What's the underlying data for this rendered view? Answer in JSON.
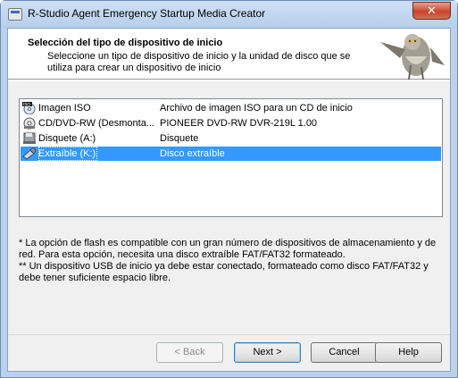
{
  "window": {
    "title": "R-Studio Agent Emergency Startup Media Creator",
    "close_label": "✕"
  },
  "header": {
    "title": "Selección del tipo de dispositivo de inicio",
    "subtitle": "Seleccione un tipo de dispositivo de inicio y la unidad de disco que se utiliza para crear un dispositivo de inicio"
  },
  "devices": [
    {
      "icon": "iso-disc-icon",
      "name": "Imagen ISO",
      "description": "Archivo de imagen ISO para un CD de inicio",
      "selected": false
    },
    {
      "icon": "optical-drive-icon",
      "name": "CD/DVD-RW (Desmonta...",
      "description": "PIONEER DVD-RW  DVR-219L 1.00",
      "selected": false
    },
    {
      "icon": "floppy-drive-icon",
      "name": "Disquete (A:)",
      "description": "Disquete",
      "selected": false
    },
    {
      "icon": "usb-drive-icon",
      "name": "Extraíble (K:)",
      "description": "Disco extraíble",
      "selected": true
    }
  ],
  "notes": {
    "line1": "* La opción de flash es compatible con un gran número de dispositivos de almacenamiento y de red. Para esta opción, necesita una disco extraíble FAT/FAT32 formateado.",
    "line2": "** Un dispositivo USB de inicio ya debe estar conectado, formateado como disco FAT/FAT32 y debe tener suficiente espacio libre."
  },
  "buttons": {
    "back": "< Back",
    "next": "Next >",
    "cancel": "Cancel",
    "help": "Help"
  },
  "colors": {
    "selection": "#3399ff",
    "titlebar": "#bcd2ec",
    "close": "#c9452c"
  }
}
